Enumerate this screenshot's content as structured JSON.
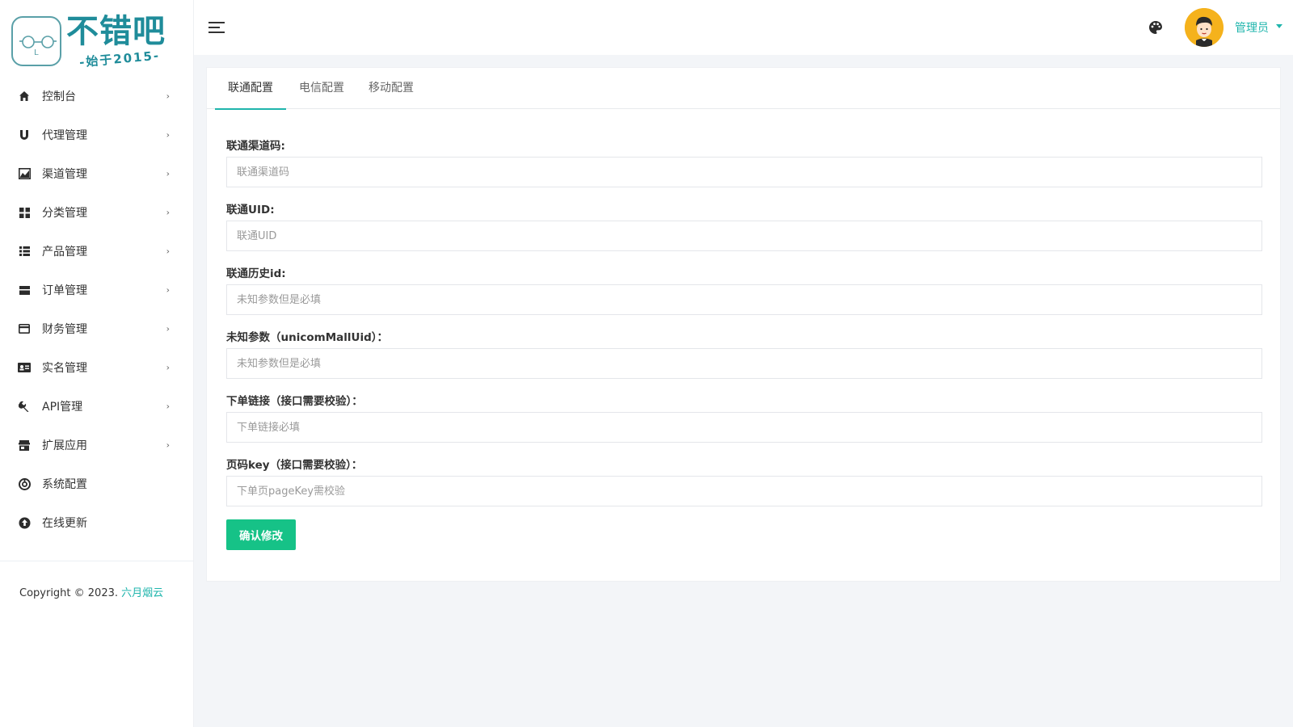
{
  "brand": {
    "logo_title": "不错吧",
    "logo_subtitle": "-始于2015-",
    "badge_letter": "L"
  },
  "sidebar": {
    "items": [
      {
        "label": "控制台",
        "icon": "home-icon",
        "has_arrow": true
      },
      {
        "label": "代理管理",
        "icon": "magnet-icon",
        "has_arrow": true
      },
      {
        "label": "渠道管理",
        "icon": "chart-line-icon",
        "has_arrow": true
      },
      {
        "label": "分类管理",
        "icon": "grid-icon",
        "has_arrow": true
      },
      {
        "label": "产品管理",
        "icon": "list-icon",
        "has_arrow": true
      },
      {
        "label": "订单管理",
        "icon": "order-icon",
        "has_arrow": true
      },
      {
        "label": "财务管理",
        "icon": "credit-card-icon",
        "has_arrow": true
      },
      {
        "label": "实名管理",
        "icon": "id-card-icon",
        "has_arrow": true
      },
      {
        "label": "API管理",
        "icon": "wrench-icon",
        "has_arrow": true
      },
      {
        "label": "扩展应用",
        "icon": "store-icon",
        "has_arrow": true
      },
      {
        "label": "系统配置",
        "icon": "settings-icon",
        "has_arrow": false
      },
      {
        "label": "在线更新",
        "icon": "upload-icon",
        "has_arrow": false
      }
    ],
    "copyright_prefix": "Copyright © 2023.",
    "copyright_brand": "六月烟云"
  },
  "header": {
    "user_name": "管理员"
  },
  "tabs": [
    {
      "label": "联通配置",
      "active": true
    },
    {
      "label": "电信配置",
      "active": false
    },
    {
      "label": "移动配置",
      "active": false
    }
  ],
  "form": {
    "fields": [
      {
        "label": "联通渠道码:",
        "placeholder": "联通渠道码",
        "value": ""
      },
      {
        "label": "联通UID:",
        "placeholder": "联通UID",
        "value": ""
      },
      {
        "label": "联通历史id:",
        "placeholder": "未知参数但是必填",
        "value": ""
      },
      {
        "label": "未知参数（unicomMallUid）：",
        "placeholder": "未知参数但是必填",
        "value": ""
      },
      {
        "label": "下单链接（接口需要校验）：",
        "placeholder": "下单链接必填",
        "value": ""
      },
      {
        "label": "页码key（接口需要校验）：",
        "placeholder": "下单页pageKey需校验",
        "value": ""
      }
    ],
    "submit_label": "确认修改"
  },
  "colors": {
    "accent": "#1fb5ac",
    "submit": "#16c287",
    "logo": "#1f8c9a",
    "avatar_bg": "#f5b21c"
  }
}
